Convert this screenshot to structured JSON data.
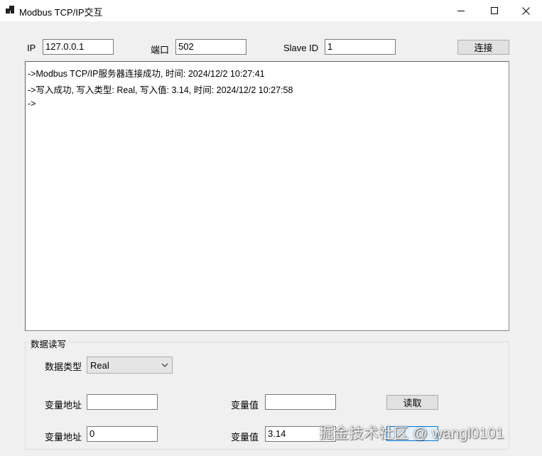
{
  "window": {
    "title": "Modbus TCP/IP交互",
    "icon": "app-window-icon",
    "controls": [
      "minimize-icon",
      "maximize-icon",
      "close-icon"
    ]
  },
  "connection": {
    "ip_label": "IP",
    "ip_value": "127.0.0.1",
    "port_label": "端口",
    "port_value": "502",
    "slave_label": "Slave ID",
    "slave_value": "1",
    "connect_button": "连接"
  },
  "log": {
    "lines": [
      "->Modbus TCP/IP服务器连接成功, 时间: 2024/12/2 10:27:41",
      "->写入成功, 写入类型: Real, 写入值: 3.14, 时间: 2024/12/2 10:27:58",
      "->"
    ]
  },
  "data_rw": {
    "group_title": "数据读写",
    "type_label": "数据类型",
    "type_selected": "Real",
    "read": {
      "addr_label": "变量地址",
      "addr_value": "",
      "value_label": "变量值",
      "value_value": "",
      "button": "读取"
    },
    "write": {
      "addr_label": "变量地址",
      "addr_value": "0",
      "value_label": "变量值",
      "value_value": "3.14"
    }
  },
  "watermark": "掘金技术社区 @ wangl0101",
  "colors": {
    "window_bg": "#f0f0f0",
    "titlebar_bg": "#ffffff",
    "focus_border": "#0078d7"
  }
}
